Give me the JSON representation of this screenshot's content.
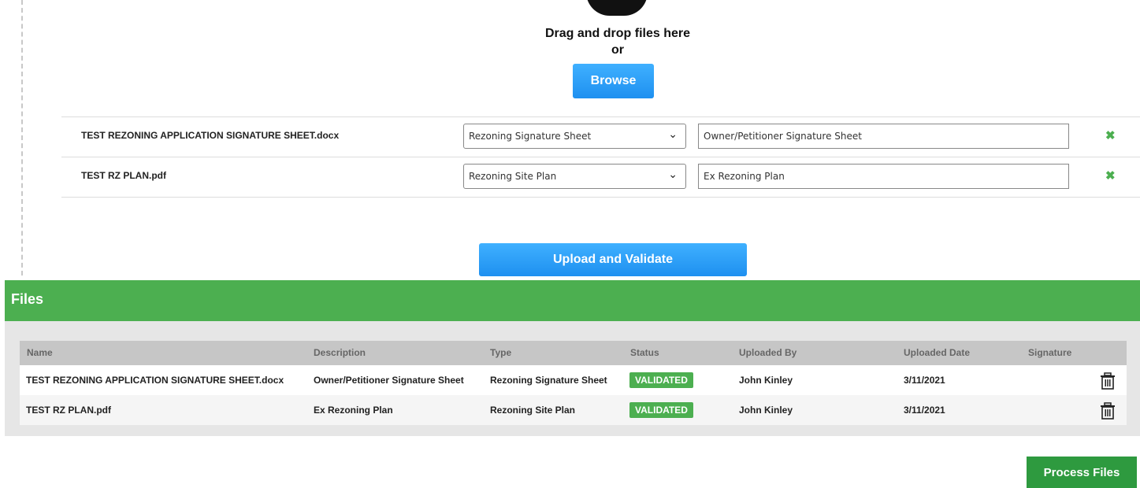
{
  "dropzone": {
    "instruction": "Drag and drop files here",
    "or_text": "or",
    "browse_label": "Browse"
  },
  "pending_files": [
    {
      "name": "TEST REZONING APPLICATION SIGNATURE SHEET.docx",
      "type": "Rezoning Signature Sheet",
      "description": "Owner/Petitioner Signature Sheet",
      "remove": "✖"
    },
    {
      "name": "TEST RZ PLAN.pdf",
      "type": "Rezoning Site Plan",
      "description": "Ex Rezoning Plan",
      "remove": "✖"
    }
  ],
  "upload_button": "Upload and Validate",
  "files_section": {
    "title": "Files",
    "columns": [
      "Name",
      "Description",
      "Type",
      "Status",
      "Uploaded By",
      "Uploaded Date",
      "Signature"
    ],
    "rows": [
      {
        "name": "TEST REZONING APPLICATION SIGNATURE SHEET.docx",
        "description": "Owner/Petitioner Signature Sheet",
        "type": "Rezoning Signature Sheet",
        "status": "VALIDATED",
        "uploaded_by": "John Kinley",
        "uploaded_date": "3/11/2021",
        "signature": ""
      },
      {
        "name": "TEST RZ PLAN.pdf",
        "description": "Ex Rezoning Plan",
        "type": "Rezoning Site Plan",
        "status": "VALIDATED",
        "uploaded_by": "John Kinley",
        "uploaded_date": "3/11/2021",
        "signature": ""
      }
    ]
  },
  "process_button": "Process Files",
  "colors": {
    "accent_blue": "#1e90f0",
    "header_green": "#4caf50",
    "status_green": "#4caf50",
    "process_green": "#2e9a3f"
  },
  "icons": {
    "upload": "upload-cloud-icon",
    "dropdown": "chevron-down-icon",
    "remove": "close-icon",
    "delete": "trash-icon"
  }
}
